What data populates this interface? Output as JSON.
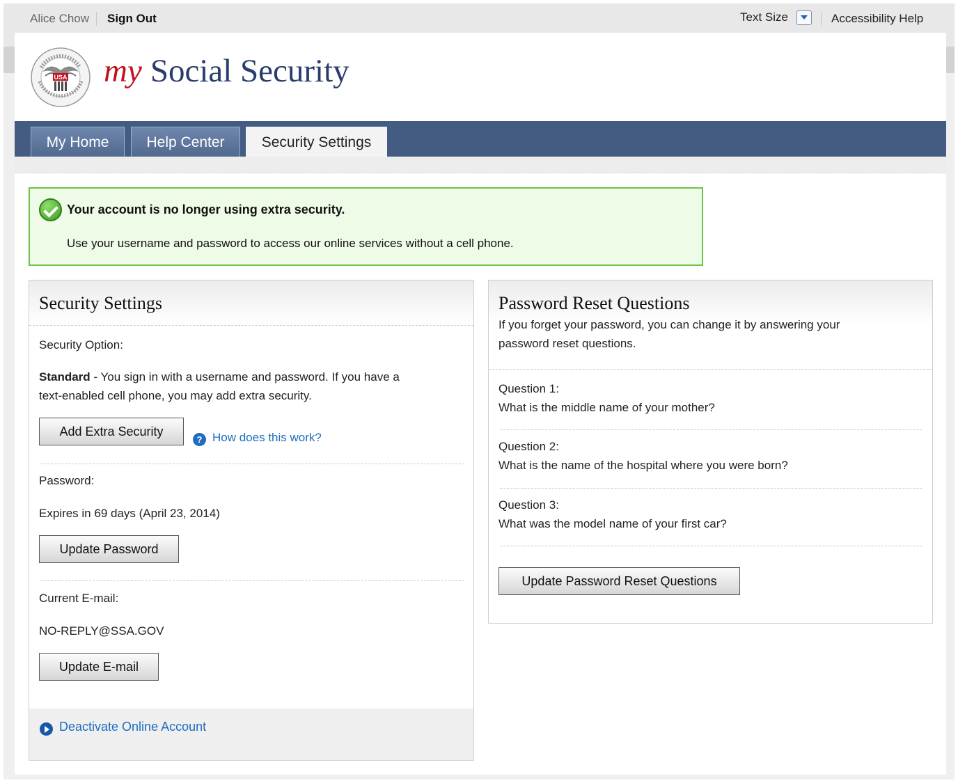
{
  "utility": {
    "user_name": "Alice Chow",
    "sign_out": "Sign Out",
    "text_size": "Text Size",
    "accessibility_help": "Accessibility Help"
  },
  "brand": {
    "my": "my",
    "name": "Social Security",
    "seal_text": "USA"
  },
  "nav": {
    "tabs": [
      {
        "label": "My Home",
        "active": false
      },
      {
        "label": "Help Center",
        "active": false
      },
      {
        "label": "Security Settings",
        "active": true
      }
    ]
  },
  "alert": {
    "heading": "Your account is no longer using extra security.",
    "body": "Use your username and password to access our online services without a cell phone."
  },
  "security_settings": {
    "title": "Security Settings",
    "option_label": "Security Option:",
    "option_strong": "Standard",
    "option_text_1": " - You sign in with a username and password. If you have a",
    "option_text_2": "text-enabled cell phone, you may add extra security.",
    "add_extra_button": "Add Extra Security",
    "how_link": "How does this work?",
    "password_label": "Password:",
    "password_expiry": "Expires in 69 days (April 23, 2014)",
    "update_password_button": "Update Password",
    "email_label": "Current E-mail:",
    "email_value": "NO-REPLY@SSA.GOV",
    "update_email_button": "Update E-mail",
    "deactivate_link": "Deactivate Online Account"
  },
  "reset_questions": {
    "title": "Password Reset Questions",
    "intro_1": "If you forget your password, you can change it by answering your",
    "intro_2": "password reset questions.",
    "questions": [
      {
        "label": "Question 1:",
        "text": "What is the middle name of your mother?"
      },
      {
        "label": "Question 2:",
        "text": "What is the name of the hospital where you were born?"
      },
      {
        "label": "Question 3:",
        "text": "What was the model name of your first car?"
      }
    ],
    "update_button": "Update Password Reset Questions"
  },
  "colors": {
    "nav_bar": "#445b82",
    "brand_blue": "#2b3c6b",
    "brand_red": "#c1121f",
    "success_bg": "#eefbe6",
    "success_border": "#6dc24f",
    "link": "#1e6cbf"
  }
}
